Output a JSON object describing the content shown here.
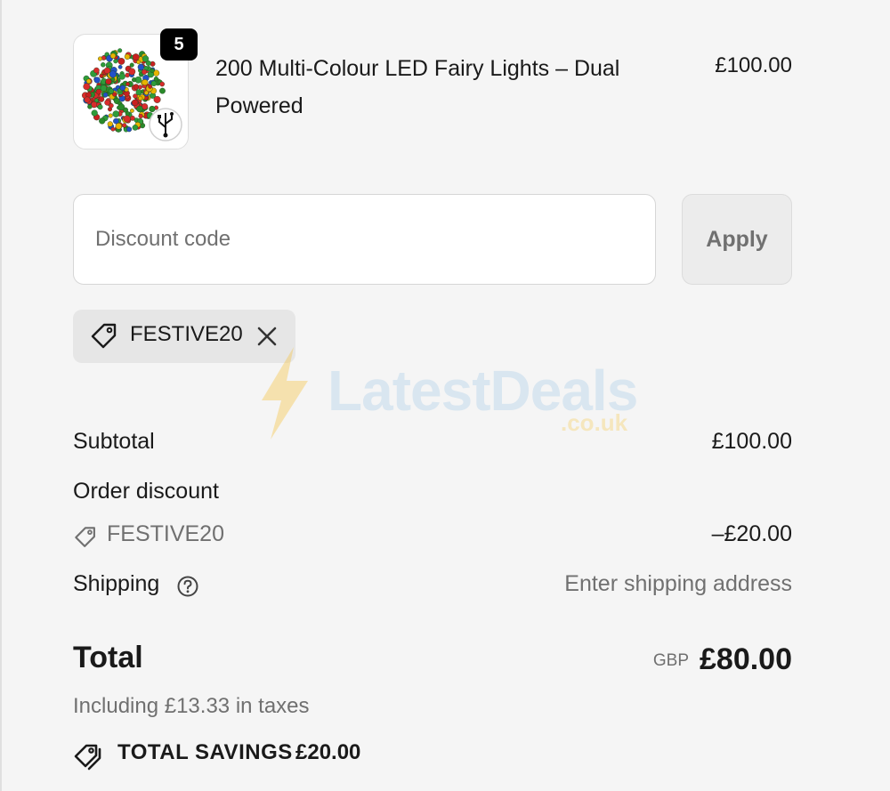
{
  "product": {
    "quantity": "5",
    "title": "200 Multi-Colour LED Fairy Lights – Dual Powered",
    "price": "£100.00",
    "image_icon": "fairy-lights-thumbnail"
  },
  "discount": {
    "placeholder": "Discount code",
    "value": "",
    "apply_label": "Apply",
    "applied_code": "FESTIVE20"
  },
  "watermark": {
    "brand": "LatestDeals",
    "domain": ".co.uk"
  },
  "summary": {
    "subtotal_label": "Subtotal",
    "subtotal_value": "£100.00",
    "order_discount_label": "Order discount",
    "discount_code": "FESTIVE20",
    "discount_value": "–£20.00",
    "shipping_label": "Shipping",
    "shipping_value": "Enter shipping address",
    "total_label": "Total",
    "currency": "GBP",
    "total_value": "£80.00",
    "taxes_note": "Including £13.33 in taxes",
    "savings_label": "TOTAL SAVINGS",
    "savings_value": "£20.00"
  },
  "colors": {
    "background": "#f5f5f5",
    "text": "#1a1a1a",
    "muted": "#707070",
    "badge": "#000000"
  }
}
